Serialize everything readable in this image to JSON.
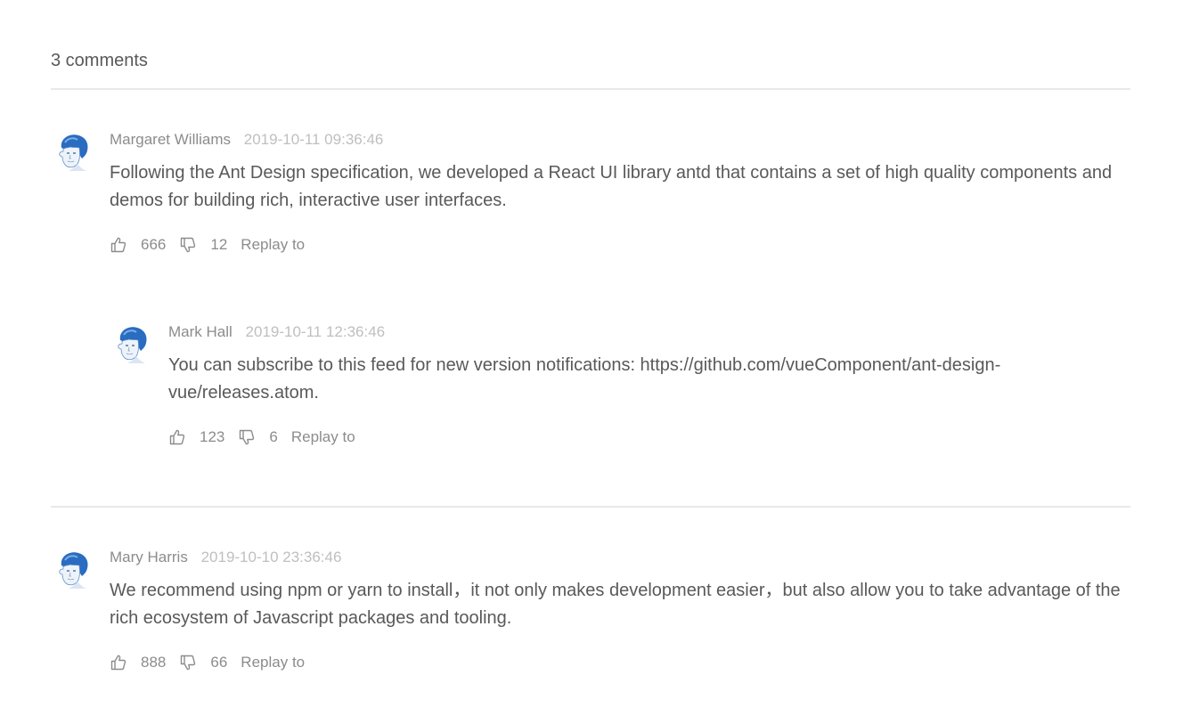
{
  "comment_count_label": "3 comments",
  "colors": {
    "author": "#8c8c8c",
    "time": "#bfbfbf",
    "text": "#595959",
    "divider": "#e8e8e8",
    "avatar_accent": "#1f63b8"
  },
  "comments": [
    {
      "author": "Margaret Williams",
      "time": "2019-10-11 09:36:46",
      "text": "Following the Ant Design specification, we developed a React UI library antd that contains a set of high quality components and demos for building rich, interactive user interfaces.",
      "likes": "666",
      "dislikes": "12",
      "reply_label": "Replay to",
      "like_icon": "like-icon",
      "dislike_icon": "dislike-icon",
      "replies": [
        {
          "author": "Mark Hall",
          "time": "2019-10-11 12:36:46",
          "text": "You can subscribe to this feed for new version notifications: https://github.com/vueComponent/ant-design-vue/releases.atom.",
          "likes": "123",
          "dislikes": "6",
          "reply_label": "Replay to"
        }
      ]
    },
    {
      "author": "Mary Harris",
      "time": "2019-10-10 23:36:46",
      "text": "We recommend using npm or yarn to install，it not only makes development easier，but also allow you to take advantage of the rich ecosystem of Javascript packages and tooling.",
      "likes": "888",
      "dislikes": "66",
      "reply_label": "Replay to",
      "replies": []
    }
  ]
}
